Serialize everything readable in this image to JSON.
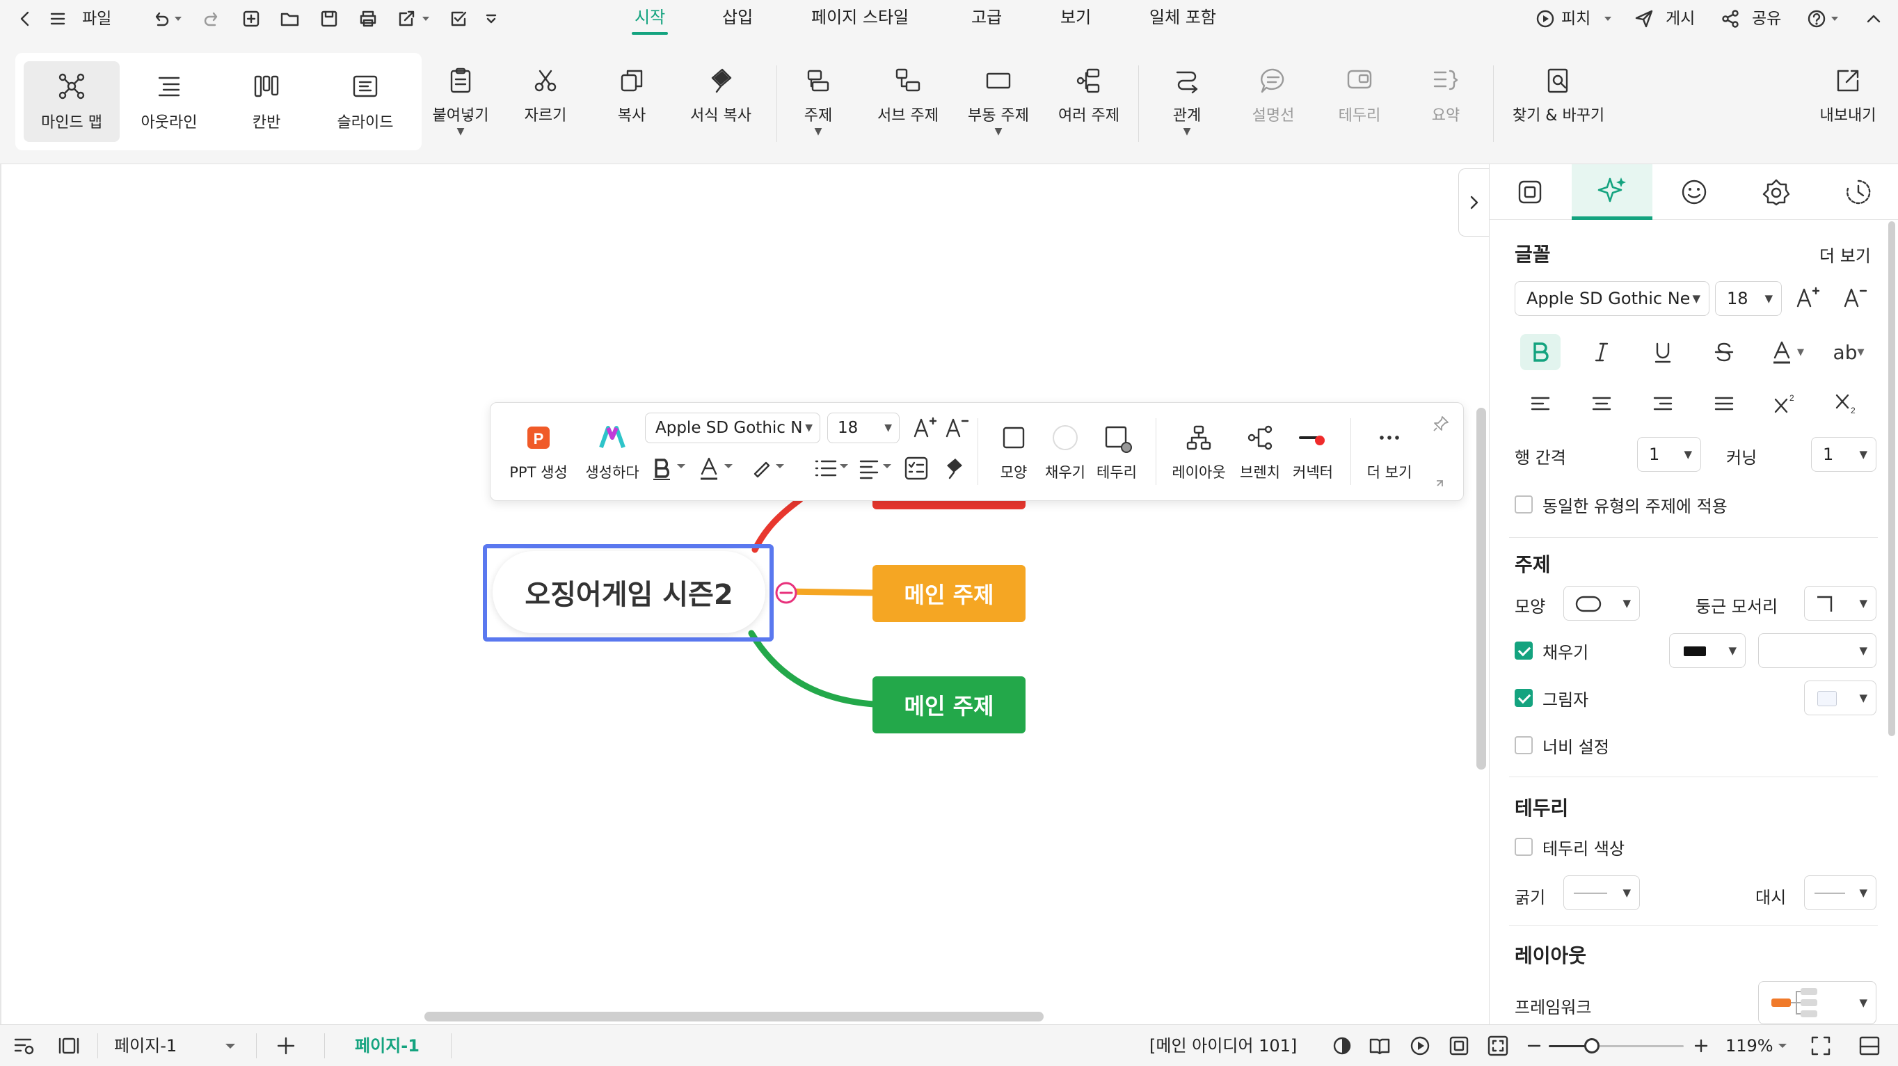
{
  "titlebar": {
    "file_label": "파일",
    "menus": [
      "시작",
      "삽입",
      "페이지 스타일",
      "고급",
      "보기",
      "일체 포함"
    ],
    "active_menu": "시작",
    "pitch_label": "피치",
    "publish_label": "게시",
    "share_label": "공유"
  },
  "ribbon": {
    "views": [
      "마인드 맵",
      "아웃라인",
      "칸반",
      "슬라이드"
    ],
    "paste": "붙여넣기",
    "cut": "자르기",
    "copy": "복사",
    "format_painter": "서식 복사",
    "topic": "주제",
    "subtopic": "서브 주제",
    "floating_topic": "부동 주제",
    "multiple_topics": "여러 주제",
    "relationship": "관계",
    "callout": "설명선",
    "boundary": "테두리",
    "summary": "요약",
    "find_replace": "찾기 & 바꾸기",
    "export": "내보내기"
  },
  "mindmap": {
    "central_topic": "오징어게임 시즌2",
    "topics": [
      {
        "label": "메인 주제",
        "color": "#f5a623"
      },
      {
        "label": "메인 주제",
        "color": "#23a84a"
      }
    ],
    "top_branch_color": "#e8372e"
  },
  "floating_toolbar": {
    "ppt": "PPT 생성",
    "generate": "생성하다",
    "font": "Apple SD Gothic N",
    "size": "18",
    "shape": "모양",
    "fill": "채우기",
    "border": "테두리",
    "layout": "레이아웃",
    "branch": "브렌치",
    "connector": "커넥터",
    "more": "더 보기"
  },
  "panel": {
    "font_heading": "글꼴",
    "more": "더 보기",
    "font": "Apple SD Gothic Neo",
    "size": "18",
    "line_spacing_label": "행 간격",
    "line_spacing": "1",
    "kerning_label": "커닝",
    "kerning": "1",
    "apply_same": "동일한 유형의 주제에 적용",
    "topic_heading": "주제",
    "shape_label": "모양",
    "rounded_label": "둥근 모서리",
    "fill_label": "채우기",
    "shadow_label": "그림자",
    "width_label": "너비 설정",
    "border_heading": "테두리",
    "border_color_label": "테두리 색상",
    "thickness_label": "굵기",
    "dash_label": "대시",
    "layout_heading": "레이아웃",
    "framework_label": "프레임워크"
  },
  "statusbar": {
    "page_select": "페이지-1",
    "page_tab": "페이지-1",
    "idea_count": "[메인 아이디어 101]",
    "zoom": "119%",
    "zoom_fraction": 0.32
  },
  "colors": {
    "accent": "#14a37f",
    "selection": "#5a78ef"
  }
}
